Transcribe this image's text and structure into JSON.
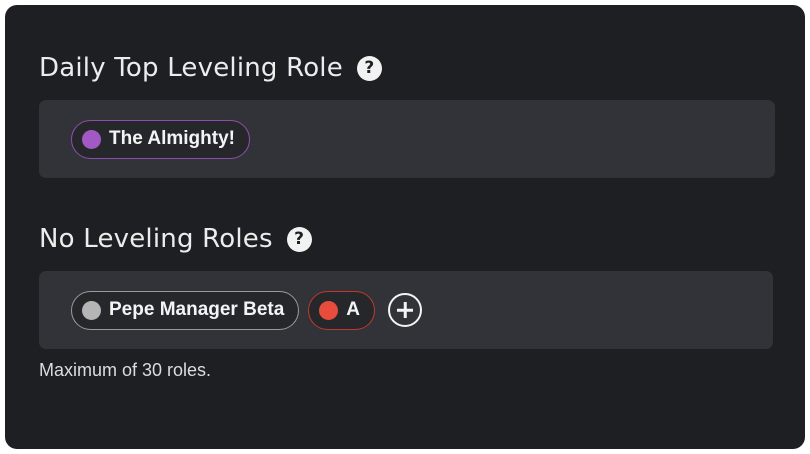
{
  "daily_top": {
    "title": "Daily Top Leveling Role",
    "help_icon": "question-mark-icon",
    "roles": [
      {
        "label": "The Almighty!",
        "color": "#a259c4",
        "border": "#8a4fae"
      }
    ]
  },
  "no_leveling": {
    "title": "No Leveling Roles",
    "help_icon": "question-mark-icon",
    "roles": [
      {
        "label": "Pepe Manager Beta",
        "color": "#b5b5b5",
        "border": "#9a9a9a"
      },
      {
        "label": "A",
        "color": "#e74c3c",
        "border": "#c0392b"
      }
    ],
    "add_icon": "plus-circle-icon",
    "hint": "Maximum of 30 roles."
  }
}
